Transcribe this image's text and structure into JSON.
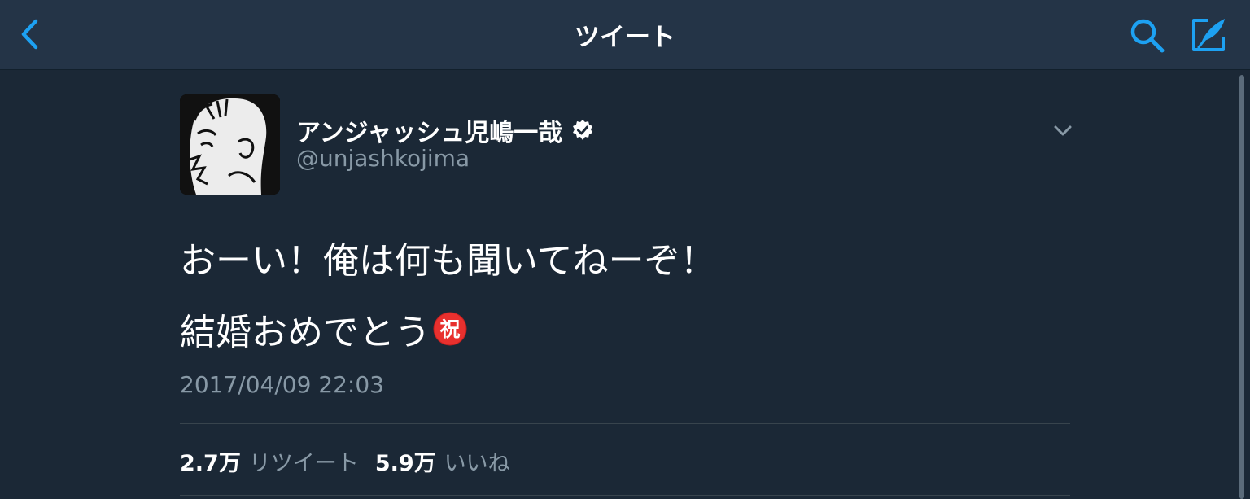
{
  "header": {
    "title": "ツイート",
    "back_icon": "chevron-left-icon",
    "search_icon": "search-icon",
    "compose_icon": "compose-tweet-icon",
    "accent_color": "#1da1f2"
  },
  "tweet": {
    "author": {
      "display_name": "アンジャッシュ児嶋一哉",
      "handle": "@unjashkojima",
      "verified": true,
      "avatar": "sketch-face-avatar"
    },
    "text_lines": [
      "おーい！俺は何も聞いてねーぞ！",
      "結婚おめでとう"
    ],
    "emoji": "祝",
    "timestamp": "2017/04/09 22:03",
    "stats": {
      "retweets_count": "2.7万",
      "retweets_label": "リツイート",
      "likes_count": "5.9万",
      "likes_label": "いいね"
    }
  },
  "colors": {
    "background": "#1b2836",
    "navbar": "#243447",
    "secondary_text": "#8899a6",
    "divider": "#38444d"
  }
}
